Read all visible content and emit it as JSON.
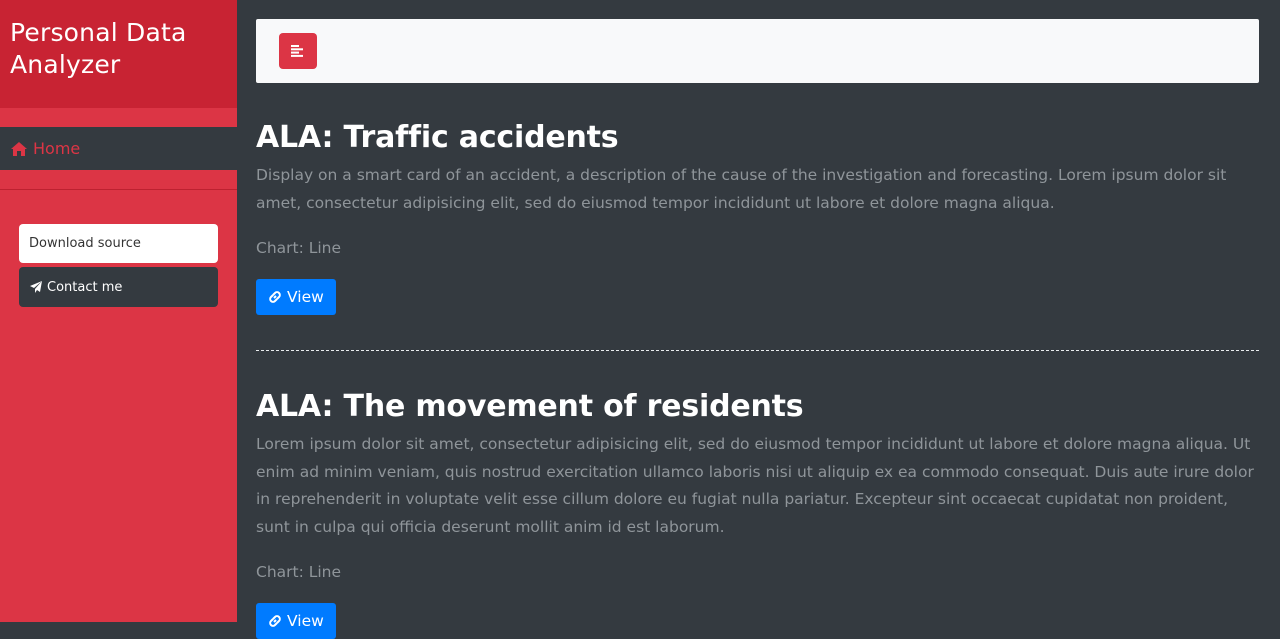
{
  "sidebar": {
    "brand": "Personal Data Analyzer",
    "nav_home": "Home",
    "download_label": "Download source",
    "contact_label": "Contact me"
  },
  "posts": [
    {
      "title": "ALA: Traffic accidents",
      "description": "Display on a smart card of an accident, a description of the cause of the investigation and forecasting. Lorem ipsum dolor sit amet, consectetur adipisicing elit, sed do eiusmod tempor incididunt ut labore et dolore magna aliqua.",
      "chart": "Chart: Line",
      "view_label": "View"
    },
    {
      "title": "ALA: The movement of residents",
      "description": "Lorem ipsum dolor sit amet, consectetur adipisicing elit, sed do eiusmod tempor incididunt ut labore et dolore magna aliqua. Ut enim ad minim veniam, quis nostrud exercitation ullamco laboris nisi ut aliquip ex ea commodo consequat. Duis aute irure dolor in reprehenderit in voluptate velit esse cillum dolore eu fugiat nulla pariatur. Excepteur sint occaecat cupidatat non proident, sunt in culpa qui officia deserunt mollit anim id est laborum.",
      "chart": "Chart: Line",
      "view_label": "View"
    }
  ],
  "colors": {
    "sidebar": "#dc3545",
    "brand_bg": "#c82333",
    "content_bg": "#343a40",
    "view_button": "#007bff"
  },
  "icons": {
    "home": "home-icon",
    "send": "paper-plane-icon",
    "toggle": "align-left-icon",
    "link": "link-icon"
  }
}
